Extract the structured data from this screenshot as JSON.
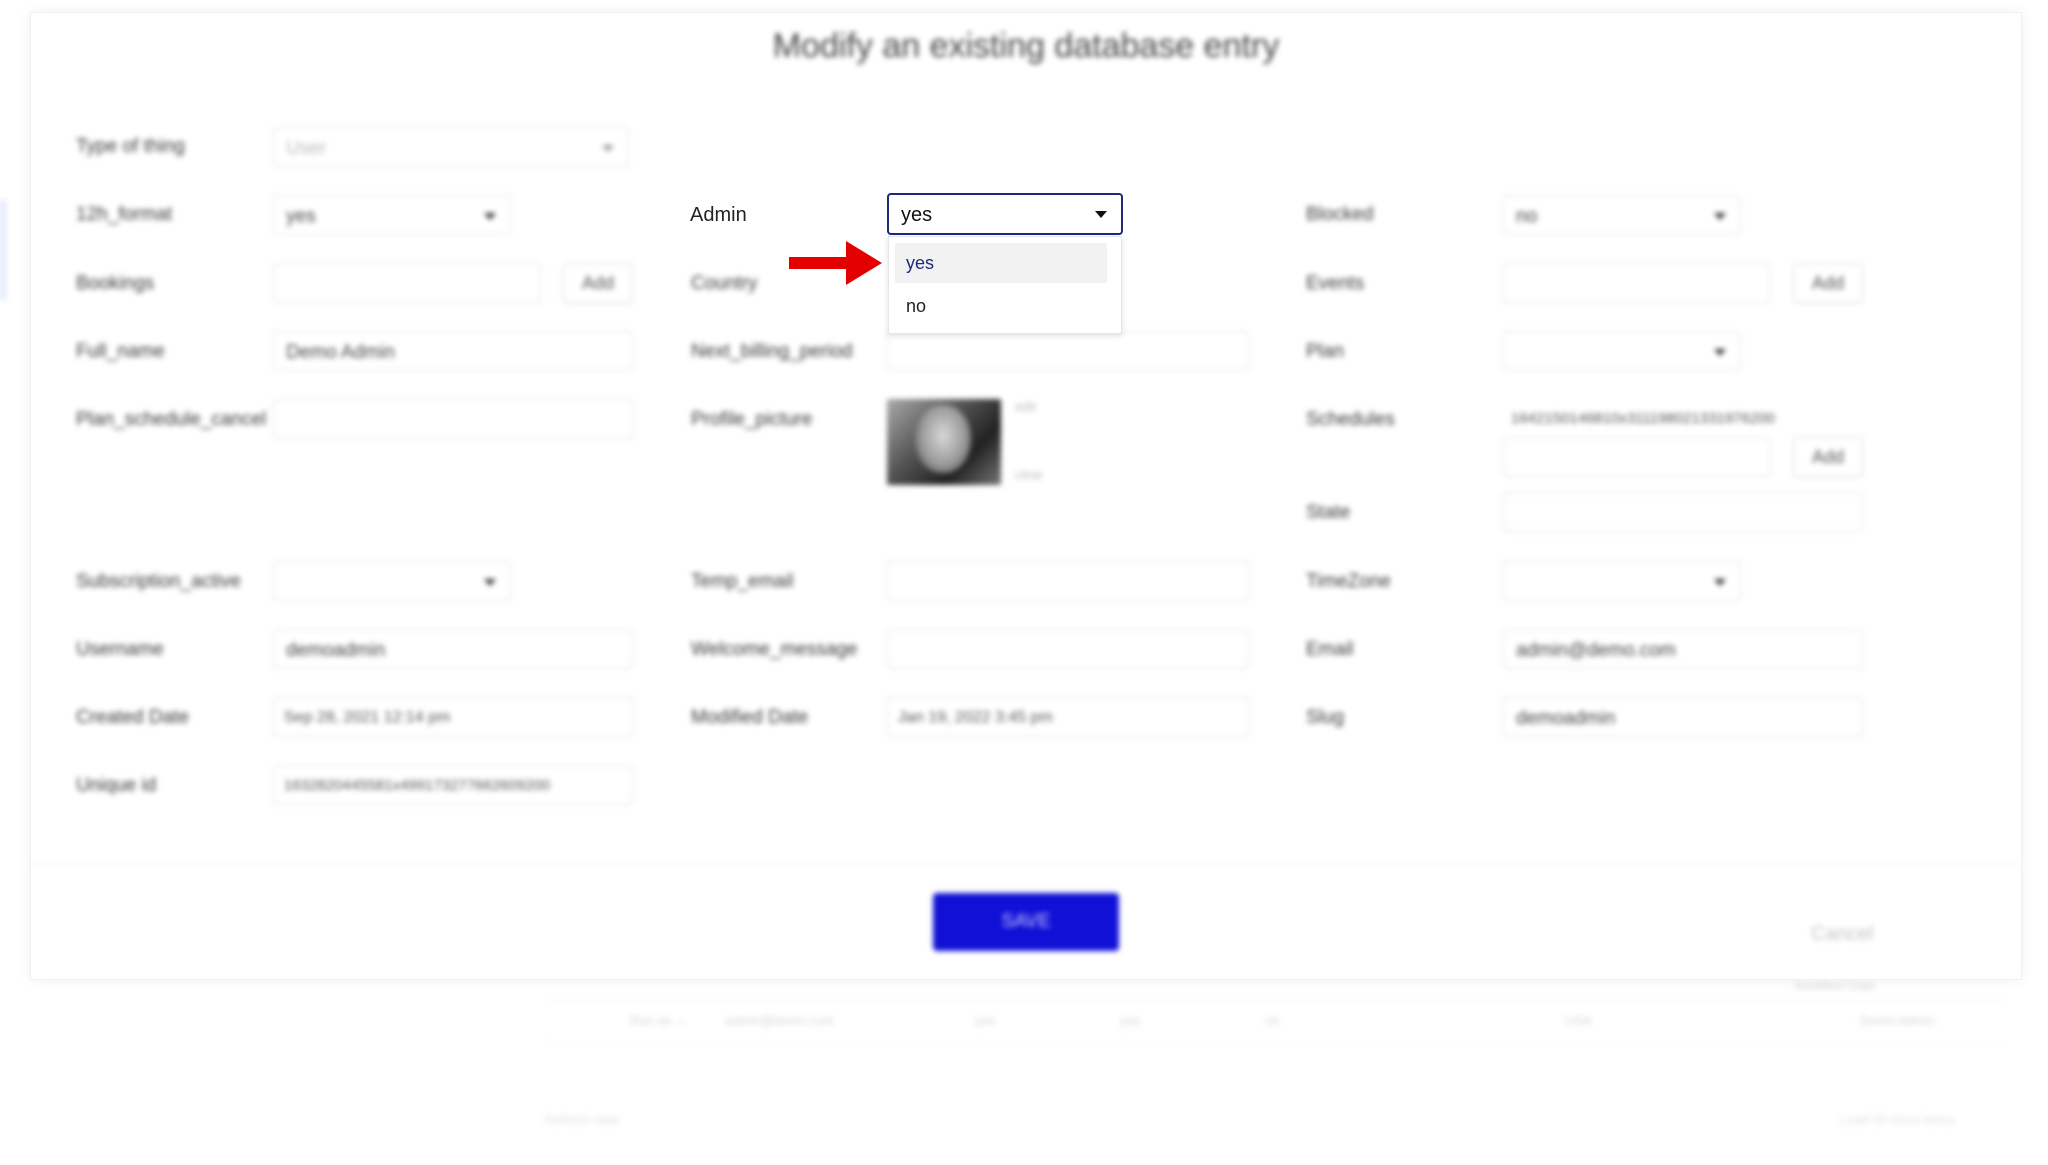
{
  "modal": {
    "title": "Modify an existing database entry",
    "col1": {
      "type_of_thing": {
        "label": "Type of thing",
        "value": "User"
      },
      "twelve_h_format": {
        "label": "12h_format",
        "value": "yes"
      },
      "bookings": {
        "label": "Bookings",
        "value": "",
        "add": "Add"
      },
      "full_name": {
        "label": "Full_name",
        "value": "Demo Admin"
      },
      "plan_schedule_cancel": {
        "label": "Plan_schedule_cancel",
        "value": ""
      },
      "subscription_active": {
        "label": "Subscription_active",
        "value": ""
      },
      "username": {
        "label": "Username",
        "value": "demoadmin"
      },
      "created_date": {
        "label": "Created Date",
        "value": "Sep 28, 2021 12:14 pm"
      },
      "unique_id": {
        "label": "Unique id",
        "value": "1632820445581x499173277662609200"
      }
    },
    "col2": {
      "admin": {
        "label": "Admin",
        "value": "yes",
        "options": [
          "yes",
          "no"
        ]
      },
      "country": {
        "label": "Country"
      },
      "next_billing_period": {
        "label": "Next_billing_period",
        "value": ""
      },
      "profile_picture": {
        "label": "Profile_picture",
        "edit": "edit",
        "clear": "clear"
      },
      "temp_email": {
        "label": "Temp_email",
        "value": ""
      },
      "welcome_message": {
        "label": "Welcome_message",
        "value": ""
      },
      "modified_date": {
        "label": "Modified Date",
        "value": "Jan 19, 2022 3:45 pm"
      }
    },
    "col3": {
      "blocked": {
        "label": "Blocked",
        "value": "no"
      },
      "events": {
        "label": "Events",
        "value": "",
        "add": "Add"
      },
      "plan": {
        "label": "Plan",
        "value": ""
      },
      "schedules": {
        "label": "Schedules",
        "item": "1642150146810x311198021331976200",
        "add": "Add"
      },
      "state": {
        "label": "State",
        "value": ""
      },
      "timezone": {
        "label": "TimeZone",
        "value": ""
      },
      "email": {
        "label": "Email",
        "value": "admin@demo.com"
      },
      "slug": {
        "label": "Slug",
        "value": "demoadmin"
      }
    },
    "save_label": "SAVE",
    "cancel_label": "Cancel"
  },
  "background": {
    "table_cells": [
      "Run as →",
      "admin@demo.com",
      "yes",
      "yes",
      "no",
      "USA",
      "Demo Admin"
    ],
    "header_cell": "Modified Date",
    "footer_left": "Refresh data",
    "footer_right": "Load 50 more items"
  },
  "colors": {
    "save_button": "#1010d6",
    "highlight": "#e40000",
    "focus_border": "#1c2a7a"
  }
}
